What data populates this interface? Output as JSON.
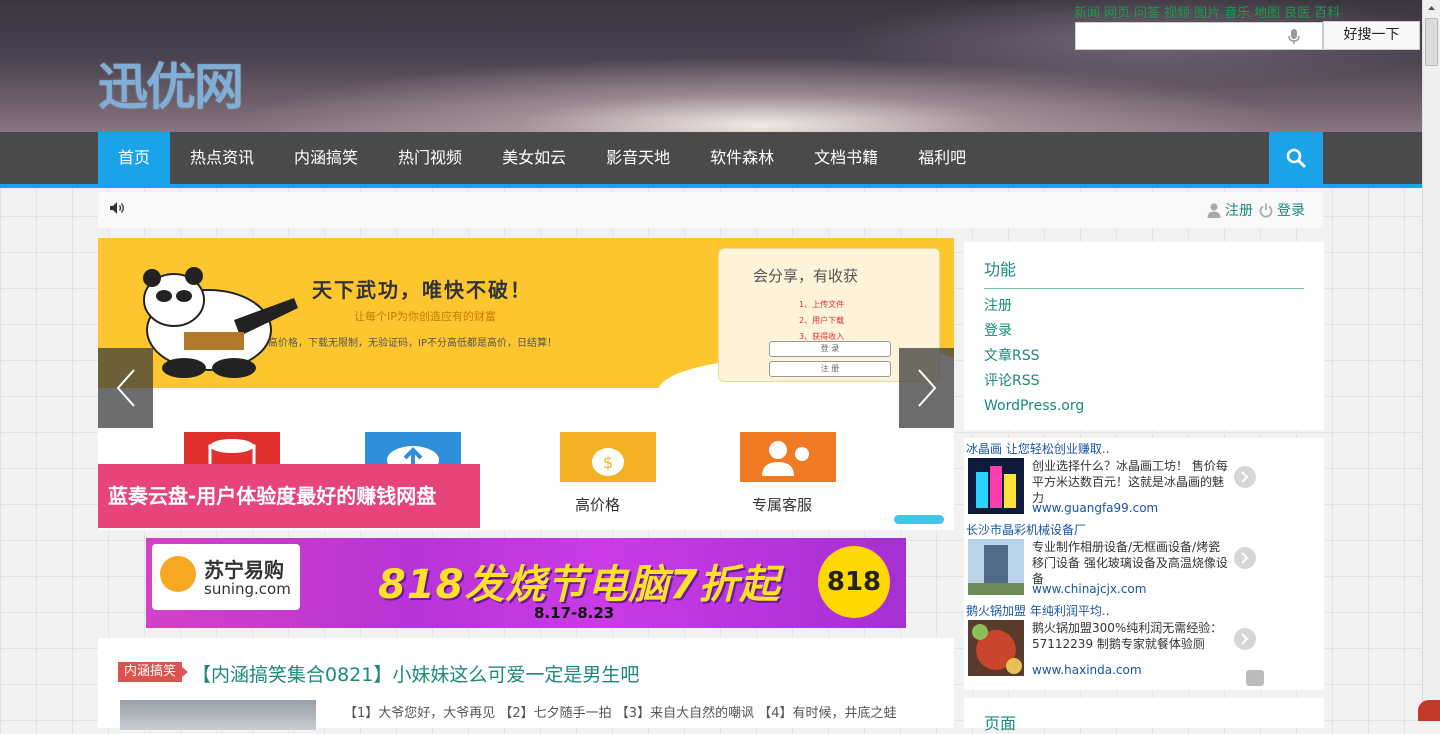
{
  "header": {
    "logo_text": "迅优网",
    "top_links": [
      "新闻",
      "网页",
      "问答",
      "视频",
      "图片",
      "音乐",
      "地图",
      "良医",
      "百科"
    ],
    "search_placeholder": "",
    "search_button": "好搜一下"
  },
  "nav": {
    "items": [
      {
        "label": "首页",
        "active": true
      },
      {
        "label": "热点资讯",
        "active": false
      },
      {
        "label": "内涵搞笑",
        "active": false
      },
      {
        "label": "热门视频",
        "active": false
      },
      {
        "label": "美女如云",
        "active": false
      },
      {
        "label": "影音天地",
        "active": false
      },
      {
        "label": "软件森林",
        "active": false
      },
      {
        "label": "文档书籍",
        "active": false
      },
      {
        "label": "福利吧",
        "active": false
      }
    ],
    "search_icon": "search-icon"
  },
  "subbar": {
    "register": "注册",
    "login": "登录"
  },
  "slider": {
    "headline": "天下武功，唯快不破！",
    "subline": "让每个IP为你创造应有的财富",
    "desc": "高价格，下载无限制，无验证码，IP不分高低都是高价，日结算！",
    "card_title": "会分享，有收获",
    "card_steps": [
      "1、上传文件",
      "2、用户下载",
      "3、获得收入"
    ],
    "card_btn_login": "登 录",
    "card_btn_register": "注 册",
    "features": [
      "高价格",
      "专属客服"
    ],
    "caption": "蓝奏云盘-用户体验度最好的赚钱网盘"
  },
  "banner": {
    "brand_name": "苏宁易购",
    "brand_domain": "suning.com",
    "text": "818发烧节电脑7折起",
    "date": "8.17-8.23",
    "badge": "818"
  },
  "post": {
    "tag": "内涵搞笑",
    "title": "【内涵搞笑集合0821】小妹妹这么可爱一定是男生吧",
    "excerpt": "【1】大爷您好，大爷再见 【2】七夕随手一拍 【3】来自大自然的嘲讽 【4】有时候，井底之蛙"
  },
  "sidebar": {
    "widget_title": "功能",
    "links": [
      "注册",
      "登录",
      "文章RSS",
      "评论RSS",
      "WordPress.org"
    ],
    "ads": [
      {
        "title": "冰晶画 让您轻松创业赚取..",
        "desc": "创业选择什么？冰晶画工坊！ 售价每平方米达数百元！这就是冰晶画的魅力",
        "url": "www.guangfa99.com"
      },
      {
        "title": "长沙市晶彩机械设备厂",
        "desc": "专业制作相册设备/无框画设备/烤瓷移门设备 强化玻璃设备及高温烧像设备",
        "url": "www.chinajcjx.com"
      },
      {
        "title": "鹅火锅加盟 年纯利润平均..",
        "desc": "鹅火锅加盟300%纯利润无需经验：57112239 制鹅专家就餐体验厕",
        "url": "www.haxinda.com"
      }
    ],
    "widget2_title": "页面"
  },
  "colors": {
    "nav_bg": "#4a4a4a",
    "accent": "#1aa3e8",
    "link_green": "#1b8a78",
    "caption_pink": "#e7457a"
  }
}
